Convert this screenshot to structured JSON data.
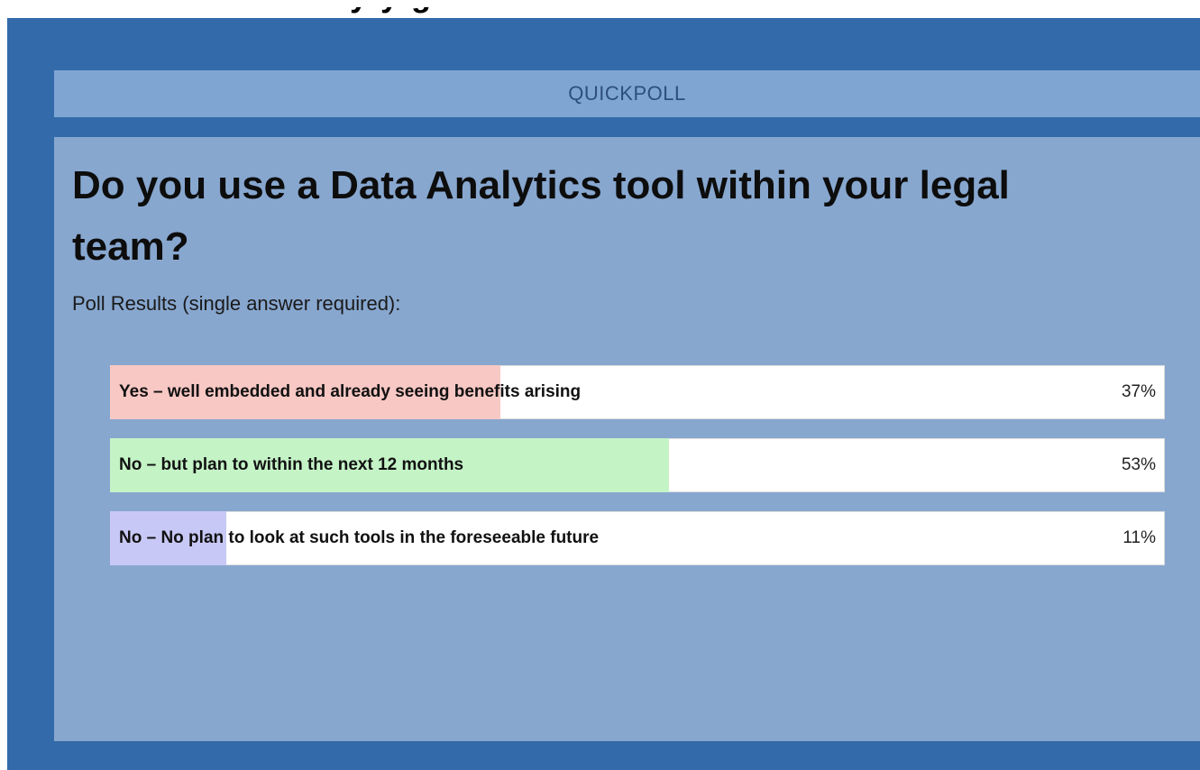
{
  "header": {
    "partial_top_text": "y                               y  g"
  },
  "poll": {
    "title": "QUICKPOLL",
    "question": "Do you use a Data Analytics tool within your legal team?",
    "subtitle": "Poll Results (single answer required):",
    "options": [
      {
        "label": "Yes – well embedded and already seeing benefits arising",
        "percent": 37,
        "percent_label": "37%",
        "color": "#f8c8c4"
      },
      {
        "label": "No – but plan to within the next 12 months",
        "percent": 53,
        "percent_label": "53%",
        "color": "#c4f3c6"
      },
      {
        "label": "No – No plan to look at such tools in the foreseeable future",
        "percent": 11,
        "percent_label": "11%",
        "color": "#c8c8f6"
      }
    ]
  }
}
